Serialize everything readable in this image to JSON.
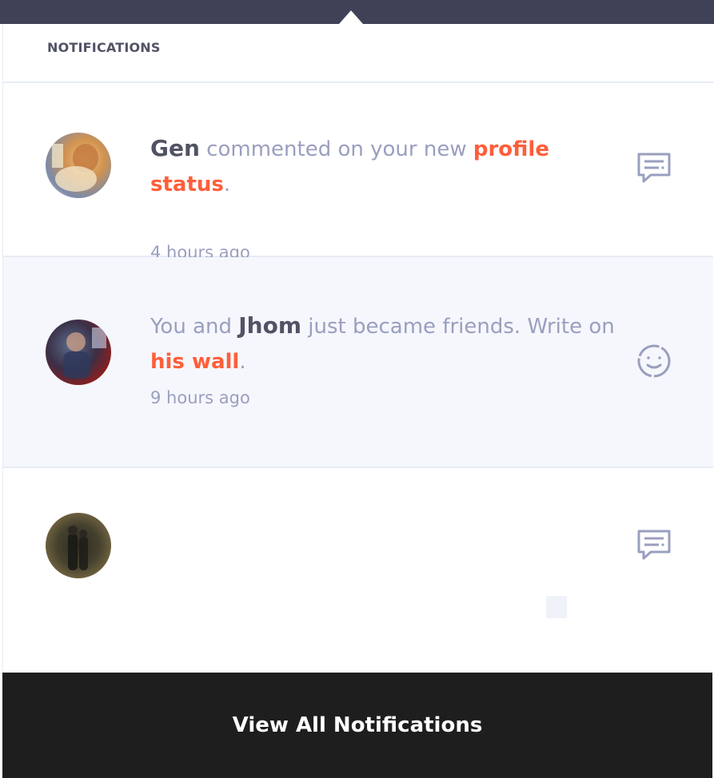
{
  "header": {
    "title": "NOTIFICATIONS"
  },
  "notifications": [
    {
      "name": "Gen",
      "before": "",
      "middle": " commented on your new ",
      "link": "profile status",
      "after": ".",
      "time": "4 hours ago",
      "icon": "comment-icon",
      "highlighted": false
    },
    {
      "before": "You and ",
      "name": "Jhom",
      "middle": " just became friends. Write on ",
      "link": "his wall",
      "after": ".",
      "time": "9 hours ago",
      "icon": "smiley-icon",
      "highlighted": true
    },
    {
      "name": "",
      "before": "",
      "middle": "",
      "link": "",
      "after": "",
      "time": "",
      "icon": "comment-icon",
      "highlighted": false
    }
  ],
  "footer": {
    "label": "View All Notifications"
  },
  "colors": {
    "topbar": "#3f4257",
    "accent": "#ff5e3a",
    "muted_text": "#9a9fbf",
    "dark_text": "#515365",
    "highlight_bg": "#f5f7fc",
    "footer_bg": "#1e1e1e"
  }
}
